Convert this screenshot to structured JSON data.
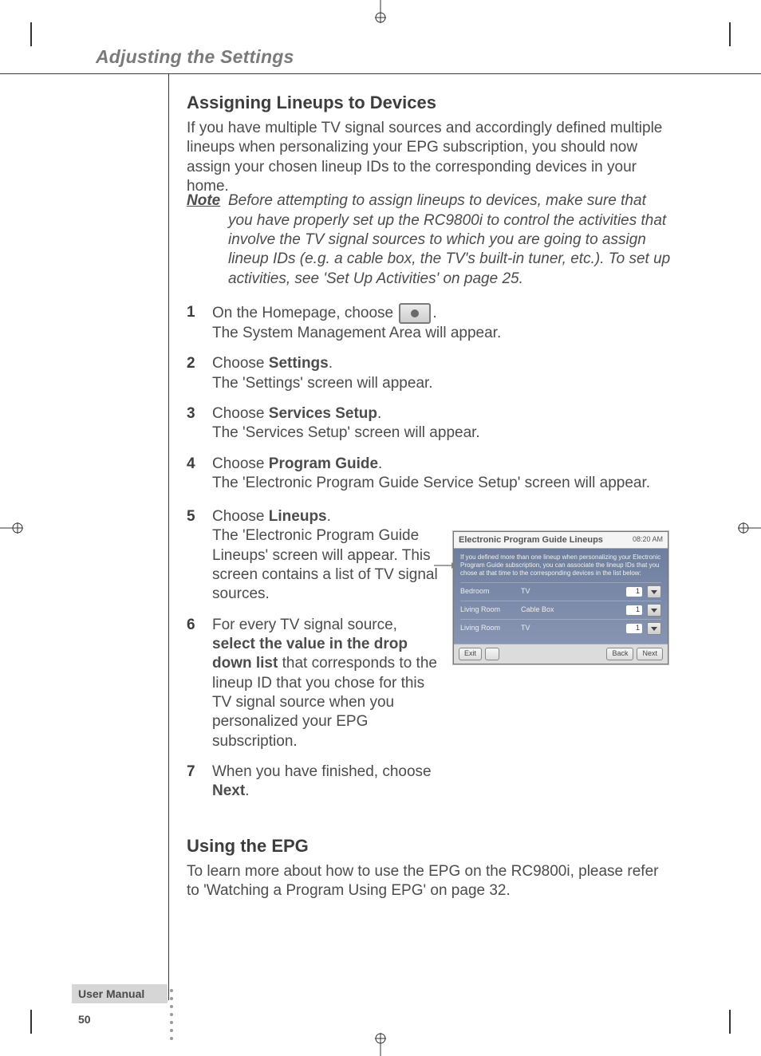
{
  "running_head": "Adjusting the Settings",
  "section1": {
    "title": "Assigning Lineups to Devices",
    "intro": "If you have multiple TV signal sources and accordingly defined multiple lineups when personalizing your EPG subscription, you should now assign your chosen lineup IDs to the corresponding devices in your home.",
    "note_label": "Note",
    "note_body": "Before attempting to assign lineups to devices, make sure that you have properly set up the RC9800i to control the activities that involve the TV signal sources to which you are going to assign lineup IDs (e.g. a cable box, the TV's built-in tuner, etc.). To set up activities, see 'Set Up Activities' on page 25.",
    "steps": [
      {
        "n": "1",
        "lead": "On the Homepage, choose ",
        "afterIcon": ".",
        "secondary": "The System Management Area will appear."
      },
      {
        "n": "2",
        "lead": "Choose ",
        "bold": "Settings",
        "tail": ".",
        "secondary": "The 'Settings' screen will appear."
      },
      {
        "n": "3",
        "lead": "Choose ",
        "bold": "Services Setup",
        "tail": ".",
        "secondary": "The 'Services Setup' screen will appear."
      },
      {
        "n": "4",
        "lead": "Choose ",
        "bold": "Program Guide",
        "tail": ".",
        "secondary": "The 'Electronic Program Guide Service Setup' screen will appear."
      },
      {
        "n": "5",
        "lead": "Choose ",
        "bold": "Lineups",
        "tail": ".",
        "secondary": "The 'Electronic Program Guide Lineups' screen will appear. This screen contains a list of TV signal sources."
      },
      {
        "n": "6",
        "lead": "For every TV signal source, ",
        "bold": "select the value in the drop down list",
        "tail": " that corresponds to the lineup ID that you chose for this TV signal source when you personalized your EPG subscription."
      },
      {
        "n": "7",
        "lead": "When you have finished, choose ",
        "bold": "Next",
        "tail": "."
      }
    ]
  },
  "section2": {
    "title": "Using the EPG",
    "body": "To learn more about how to use the EPG on the RC9800i, please refer to 'Watching a Program Using EPG' on page 32."
  },
  "screenshot": {
    "title": "Electronic Program Guide Lineups",
    "time": "08:20 AM",
    "helptext": "If you defined more than one lineup when personalizing your Electronic Program Guide subscription, you can associate the lineup IDs that you chose at that time to the corresponding devices in the list below:",
    "rows": [
      {
        "device": "Bedroom",
        "source": "TV",
        "value": "1"
      },
      {
        "device": "Living Room",
        "source": "Cable Box",
        "value": "1"
      },
      {
        "device": "Living Room",
        "source": "TV",
        "value": "1"
      }
    ],
    "buttons": {
      "exit": "Exit",
      "back": "Back",
      "next": "Next"
    }
  },
  "footer": {
    "label": "User Manual",
    "page": "50"
  }
}
